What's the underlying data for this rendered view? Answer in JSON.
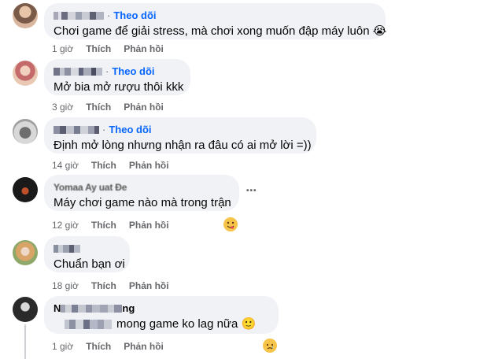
{
  "comments": [
    {
      "follow": "Theo dõi",
      "text": "Chơi game để giải stress, mà chơi xong muốn đập máy luôn 😭",
      "time": "1 giờ",
      "like": "Thích",
      "reply": "Phản hồi"
    },
    {
      "follow": "Theo dõi",
      "text": "Mở bia mở rượu thôi kkk",
      "time": "3 giờ",
      "like": "Thích",
      "reply": "Phản hồi"
    },
    {
      "follow": "Theo dõi",
      "text": "Định mở lòng nhưng nhận ra đâu có ai mở lời =))",
      "time": "14 giờ",
      "like": "Thích",
      "reply": "Phản hồi"
    },
    {
      "name": "Yomaa Ay uat Đe",
      "text": "Máy chơi game nào mà trong trận",
      "time": "12 giờ",
      "like": "Thích",
      "reply": "Phản hồi",
      "more": "•••"
    },
    {
      "text": "Chuẩn bạn ơi",
      "time": "18 giờ",
      "like": "Thích",
      "reply": "Phản hồi"
    },
    {
      "name_visible": "N",
      "name_tail": "ng",
      "text": "mong game ko lag nữa 🙂",
      "time": "1 giờ",
      "like": "Thích",
      "reply": "Phản hồi"
    }
  ],
  "colors": {
    "bubble": "#f0f2f5",
    "link": "#0866ff",
    "meta": "#65676b"
  }
}
